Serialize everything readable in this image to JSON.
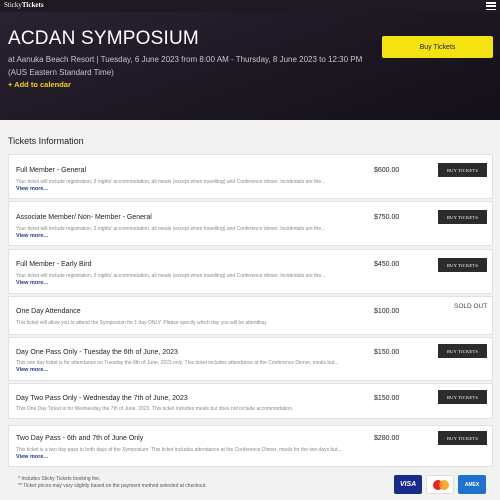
{
  "header": {
    "logo_part1": "Sticky",
    "logo_part2": "Tickets"
  },
  "event": {
    "title": "ACDAN SYMPOSIUM",
    "subtitle": "at Aanuka Beach Resort | Tuesday, 6 June 2023 from 8:00 AM - Thursday, 8 June 2023 to 12:30 PM (AUS Eastern Standard Time)",
    "add_to_calendar": "+ Add to calendar",
    "buy_button": "Buy Tickets"
  },
  "tickets_section_title": "Tickets Information",
  "view_more_label": "View more...",
  "buy_label": "BUY TICKETS",
  "tickets": [
    {
      "name": "Full Member - General",
      "description": "Your ticket will include registration, 3 nights' accommodation, all meals (except when travelling) and Conference dinner. Incidentals are the...",
      "price": "$600.00",
      "has_more": true,
      "status": "buy"
    },
    {
      "name": "Associate Member/ Non- Member - General",
      "description": "Your ticket will include registration, 3 nights' accommodation, all meals (except when travelling) and Conference dinner. Incidentals are the...",
      "price": "$750.00",
      "has_more": true,
      "status": "buy"
    },
    {
      "name": "Full Member - Early Bird",
      "description": "Your ticket will include registration, 3 nights' accommodation, all meals (except when travelling) and Conference dinner. Incidentals are the...",
      "price": "$450.00",
      "has_more": true,
      "status": "buy"
    },
    {
      "name": "One Day Attendance",
      "description": "This ticket will allow you to attend the Symposium for 1 day ONLY. Please specify which day you will be attending.",
      "price": "$100.00",
      "has_more": false,
      "status": "SOLD OUT"
    },
    {
      "name": "Day One Pass Only - Tuesday the 6th of June, 2023",
      "description": "This one day ticket is for attendance on Tuesday the 6th of June, 2023 only. This ticket includes attendance at the Conference Dinner, meals but...",
      "price": "$150.00",
      "has_more": true,
      "status": "buy"
    },
    {
      "name": "Day Two Pass Only - Wednesday the 7th of June, 2023",
      "description": "This One Day Ticket is for Wednesday the 7th of June, 2023. This ticket includes meals but does not include accommodation.",
      "price": "$150.00",
      "has_more": false,
      "status": "buy"
    },
    {
      "name": "Two Day Pass - 6th and 7th of June Only",
      "description": "This ticket is a two day pass to both days of the Symposium. This ticket includes attendance at the Conference Dinner, meals for the two days but...",
      "price": "$280.00",
      "has_more": true,
      "status": "buy"
    }
  ],
  "footnotes": {
    "line1": "* Includes Sticky Tickets booking fee.",
    "line2": "** Ticket prices may vary slightly based on the payment method selected at checkout."
  },
  "payment_methods": {
    "visa": "VISA",
    "amex": "AMEX"
  },
  "colors": {
    "accent": "#f5e212",
    "hero_bg": "#1d1a24",
    "buy_btn": "#2c2c2e"
  }
}
